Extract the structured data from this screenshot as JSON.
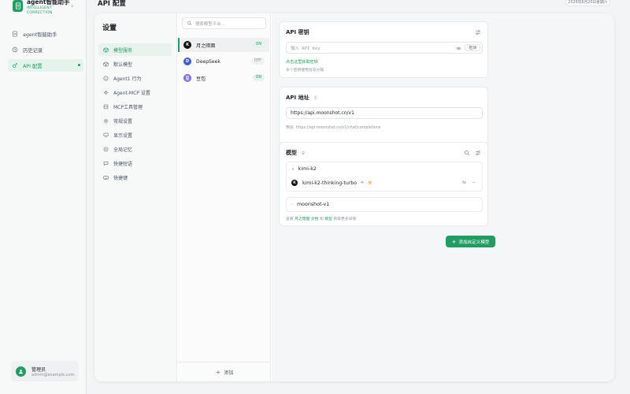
{
  "app": {
    "name": "agent智能助手",
    "subtitle_line1": "INTELLIGENT",
    "subtitle_line2": "CORRECTION"
  },
  "nav": {
    "items": [
      {
        "label": "agent智能助手",
        "icon": "document-icon"
      },
      {
        "label": "历史记录",
        "icon": "history-icon"
      },
      {
        "label": "API 配置",
        "icon": "settings-sparkle-icon",
        "active": true
      }
    ]
  },
  "user": {
    "name": "管理员",
    "email": "admin@example.com"
  },
  "header": {
    "title": "API 配置",
    "date": "2026年6月20日星期六"
  },
  "settings": {
    "title": "设置",
    "items": [
      {
        "label": "模型服务",
        "icon": "cube-icon",
        "active": true
      },
      {
        "label": "默认模型",
        "icon": "cube-outline-icon"
      },
      {
        "label": "Agent1 行为",
        "icon": "info-circle-icon"
      },
      {
        "label": "Agent-MCP 设置",
        "icon": "agent-icon"
      },
      {
        "label": "MCP工具管理",
        "icon": "server-icon"
      },
      {
        "label": "常规设置",
        "icon": "gear-icon"
      },
      {
        "label": "显示设置",
        "icon": "monitor-icon"
      },
      {
        "label": "全局记忆",
        "icon": "memory-icon"
      },
      {
        "label": "快捷短语",
        "icon": "chat-icon"
      },
      {
        "label": "快捷键",
        "icon": "keyboard-icon"
      }
    ]
  },
  "providers": {
    "search_placeholder": "搜索模型平台...",
    "items": [
      {
        "name": "月之暗面",
        "status": "ON",
        "initial": "K",
        "color": "#111111",
        "active": true
      },
      {
        "name": "DeepSeek",
        "status": "OFF",
        "initial": "D",
        "color": "#3b5bdb"
      },
      {
        "name": "豆包",
        "status": "ON",
        "initial": "豆",
        "color": "#7c6cf0"
      }
    ],
    "add_label": "添加"
  },
  "api_key": {
    "title": "API 密钥",
    "placeholder": "输入 API Key",
    "check_label": "检测",
    "link": "点击这里获取密钥",
    "hint": "多个密钥使用逗号分隔"
  },
  "api_url": {
    "title": "API 地址",
    "help": "?",
    "value": "https://api.moonshot.cn/v1",
    "preview": "预览: https://api.moonshot.cn/v1/chat/completions"
  },
  "models": {
    "title": "模型",
    "count": "2",
    "groups": [
      {
        "name": "kimi-k2",
        "expanded": true,
        "models": [
          {
            "name": "kimi-k2-thinking-turbo",
            "initial": "K"
          }
        ]
      },
      {
        "name": "moonshot-v1",
        "expanded": false,
        "models": []
      }
    ],
    "footer_pre": "查看 ",
    "footer_link1": "月之暗面 文档",
    "footer_mid": " 和 ",
    "footer_link2": "模型",
    "footer_post": " 获取更多详情"
  },
  "add_custom_model": "添加自定义模型",
  "colors": {
    "accent": "#1f9d63",
    "accent_bg": "#e4f3ec"
  }
}
